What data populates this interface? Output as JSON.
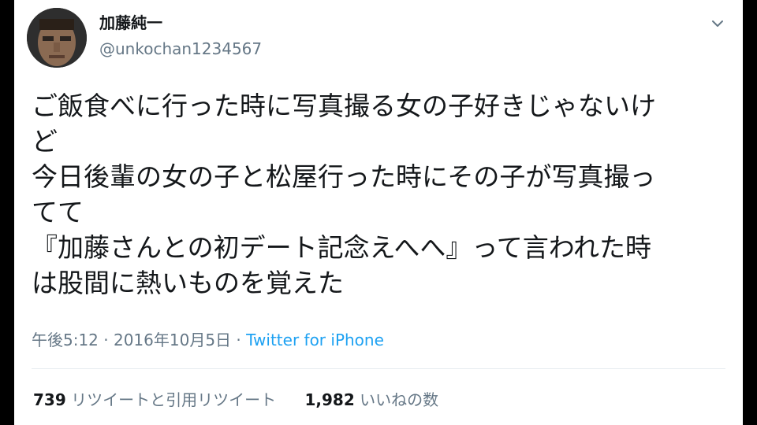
{
  "tweet": {
    "author_name": "加藤純一",
    "author_handle": "@unkochan1234567",
    "lines": [
      "ご飯食べに行った時に写真撮る女の子好きじゃないけ",
      "ど",
      "今日後輩の女の子と松屋行った時にその子が写真撮っ",
      "てて",
      "『加藤さんとの初デート記念えへへ』って言われた時",
      "は股間に熱いものを覚えた"
    ],
    "timestamp": "午後5:12 · 2016年10月5日",
    "separator": " · ",
    "source": "Twitter for iPhone",
    "retweets": {
      "count": "739",
      "label": "リツイートと引用リツイート"
    },
    "likes": {
      "count": "1,982",
      "label": "いいねの数"
    }
  },
  "icons": {
    "avatar": "avatar",
    "caret": "chevron-down-icon"
  },
  "colors": {
    "text": "#14171a",
    "secondary": "#657786",
    "link": "#1da1f2",
    "divider": "#e6ecf0",
    "background": "#ffffff",
    "frame": "#000000"
  }
}
